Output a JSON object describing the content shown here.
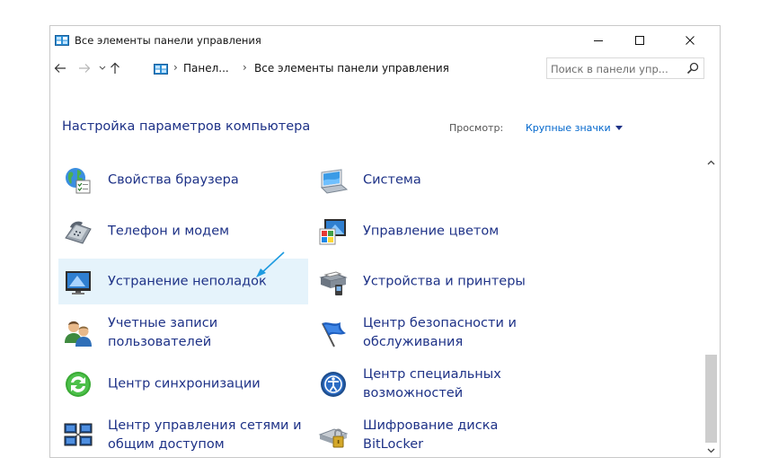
{
  "window": {
    "title": "Все элементы панели управления",
    "minimize_glyph": "—",
    "maximize_glyph": "☐",
    "close_glyph": "✕"
  },
  "nav": {
    "back_icon": "arrow-left-icon",
    "forward_icon": "arrow-right-icon",
    "recent_icon": "chevron-down-icon",
    "up_icon": "arrow-up-icon",
    "breadcrumbs": [
      "Панел...",
      "Все элементы панели управления"
    ],
    "separator": "›",
    "refresh_icon": "refresh-icon"
  },
  "search": {
    "placeholder": "Поиск в панели упр..."
  },
  "header": {
    "title": "Настройка параметров компьютера",
    "view_label": "Просмотр:",
    "view_value": "Крупные значки"
  },
  "items": {
    "col1": [
      {
        "label": "Свойства браузера",
        "icon": "internet-options-icon"
      },
      {
        "label": "Телефон и модем",
        "icon": "phone-modem-icon"
      },
      {
        "label": "Устранение неполадок",
        "icon": "troubleshooting-icon",
        "highlighted": true
      },
      {
        "label": "Учетные записи пользователей",
        "icon": "user-accounts-icon"
      },
      {
        "label": "Центр синхронизации",
        "icon": "sync-center-icon"
      },
      {
        "label": "Центр управления сетями и общим доступом",
        "icon": "network-sharing-icon"
      }
    ],
    "col2": [
      {
        "label": "Система",
        "icon": "system-icon"
      },
      {
        "label": "Управление цветом",
        "icon": "color-management-icon"
      },
      {
        "label": "Устройства и принтеры",
        "icon": "devices-printers-icon"
      },
      {
        "label": "Центр безопасности и обслуживания",
        "icon": "security-maintenance-icon"
      },
      {
        "label": "Центр специальных возможностей",
        "icon": "ease-of-access-icon"
      },
      {
        "label": "Шифрование диска BitLocker",
        "icon": "bitlocker-icon"
      }
    ]
  },
  "colors": {
    "link": "#1e3287",
    "accent": "#0066cc",
    "hover_bg": "#e5f3fb",
    "annotation": "#1e9be0"
  }
}
